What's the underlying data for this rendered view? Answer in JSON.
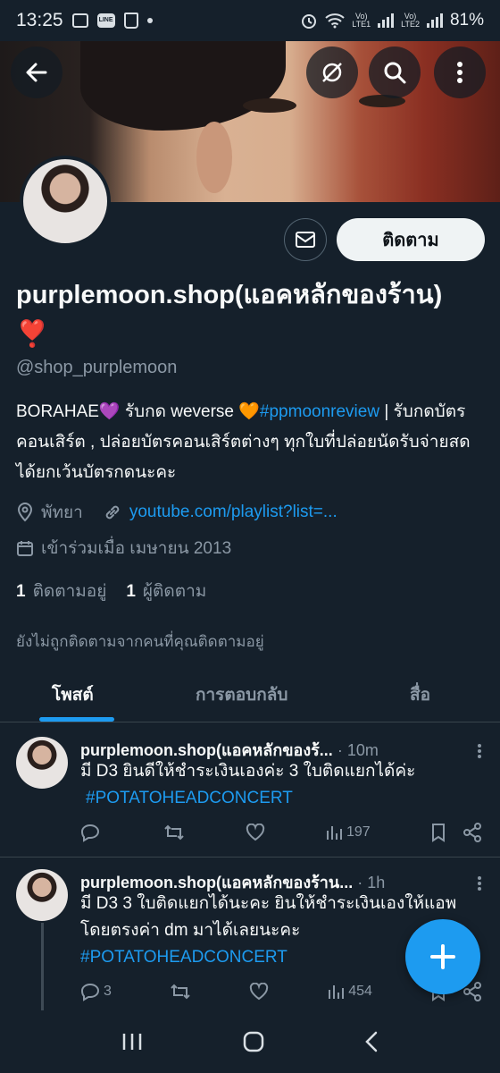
{
  "status_bar": {
    "time": "13:25",
    "battery": "81%",
    "line_label": "LINE",
    "lte1": "LTE1",
    "lte2": "LTE2",
    "vol": "Vo)"
  },
  "profile": {
    "display_name": "purplemoon.shop(แอคหลักของร้าน)",
    "heart": "❣️",
    "handle": "@shop_purplemoon",
    "follow_label": "ติดตาม",
    "bio_parts": {
      "a": "BORAHAE💜 รับกด weverse 🧡",
      "hashtag": "#ppmoonreview",
      "b": " | รับกดบัตรคอนเสิร์ต , ปล่อยบัตรคอนเสิร์ตต่างๆ ทุกใบที่ปล่อยนัดรับจ่ายสด ได้ยกเว้นบัตรกดนะคะ"
    },
    "location": "พัทยา",
    "website": "youtube.com/playlist?list=...",
    "joined": "เข้าร่วมเมื่อ เมษายน 2013",
    "following_count": "1",
    "following_label": "ติดตามอยู่",
    "followers_count": "1",
    "followers_label": "ผู้ติดตาม",
    "not_followed_note": "ยังไม่ถูกติดตามจากคนที่คุณติดตามอยู่"
  },
  "tabs": [
    {
      "label": "โพสต์"
    },
    {
      "label": "การตอบกลับ"
    },
    {
      "label": "สื่อ"
    }
  ],
  "tweets": [
    {
      "name": "purplemoon.shop(แอคหลักของร้...",
      "time": "· 10m",
      "text": "มี D3 ยินดีให้ชำระเงินเองค่ะ 3 ใบติดแยกได้ค่ะ",
      "hashtag": "#POTATOHEADCONCERT",
      "replies": "",
      "views": "197"
    },
    {
      "name": "purplemoon.shop(แอคหลักของร้าน...",
      "time": "· 1h",
      "text": "มี D3 3 ใบติดแยกได้นะคะ ยินให้ชำระเงินเองให้แอพโดยตรงค่า dm มาได้เลยนะคะ",
      "hashtag": "#POTATOHEADCONCERT",
      "replies": "3",
      "views": "454"
    }
  ],
  "colors": {
    "background": "#15202b",
    "accent": "#1d9bf0",
    "muted": "#8b98a5"
  }
}
